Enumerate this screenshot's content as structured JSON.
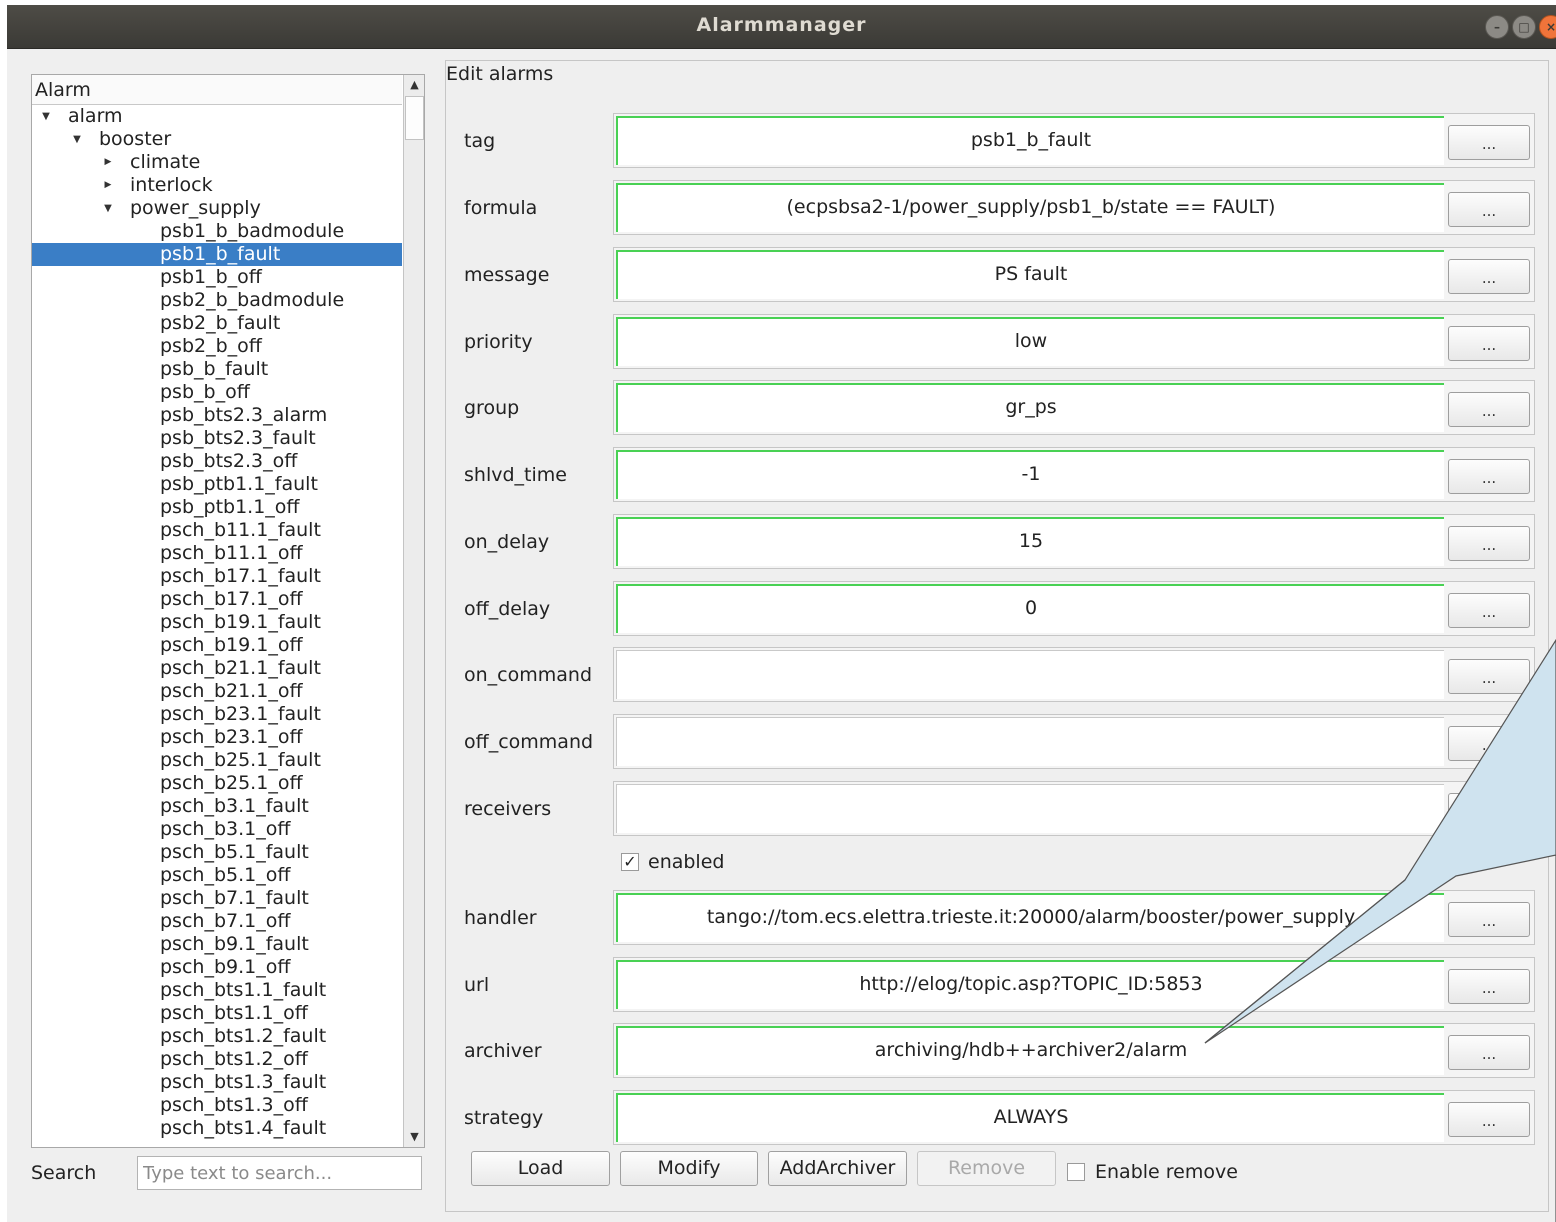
{
  "window": {
    "title": "Alarmmanager"
  },
  "tree": {
    "header": "Alarm",
    "rows": [
      {
        "label": "alarm",
        "depth": 0,
        "arrow": "down"
      },
      {
        "label": "booster",
        "depth": 1,
        "arrow": "down"
      },
      {
        "label": "climate",
        "depth": 2,
        "arrow": "right"
      },
      {
        "label": "interlock",
        "depth": 2,
        "arrow": "right"
      },
      {
        "label": "power_supply",
        "depth": 2,
        "arrow": "down"
      },
      {
        "label": "psb1_b_badmodule",
        "depth": 3
      },
      {
        "label": "psb1_b_fault",
        "depth": 3,
        "selected": true
      },
      {
        "label": "psb1_b_off",
        "depth": 3
      },
      {
        "label": "psb2_b_badmodule",
        "depth": 3
      },
      {
        "label": "psb2_b_fault",
        "depth": 3
      },
      {
        "label": "psb2_b_off",
        "depth": 3
      },
      {
        "label": "psb_b_fault",
        "depth": 3
      },
      {
        "label": "psb_b_off",
        "depth": 3
      },
      {
        "label": "psb_bts2.3_alarm",
        "depth": 3
      },
      {
        "label": "psb_bts2.3_fault",
        "depth": 3
      },
      {
        "label": "psb_bts2.3_off",
        "depth": 3
      },
      {
        "label": "psb_ptb1.1_fault",
        "depth": 3
      },
      {
        "label": "psb_ptb1.1_off",
        "depth": 3
      },
      {
        "label": "psch_b11.1_fault",
        "depth": 3
      },
      {
        "label": "psch_b11.1_off",
        "depth": 3
      },
      {
        "label": "psch_b17.1_fault",
        "depth": 3
      },
      {
        "label": "psch_b17.1_off",
        "depth": 3
      },
      {
        "label": "psch_b19.1_fault",
        "depth": 3
      },
      {
        "label": "psch_b19.1_off",
        "depth": 3
      },
      {
        "label": "psch_b21.1_fault",
        "depth": 3
      },
      {
        "label": "psch_b21.1_off",
        "depth": 3
      },
      {
        "label": "psch_b23.1_fault",
        "depth": 3
      },
      {
        "label": "psch_b23.1_off",
        "depth": 3
      },
      {
        "label": "psch_b25.1_fault",
        "depth": 3
      },
      {
        "label": "psch_b25.1_off",
        "depth": 3
      },
      {
        "label": "psch_b3.1_fault",
        "depth": 3
      },
      {
        "label": "psch_b3.1_off",
        "depth": 3
      },
      {
        "label": "psch_b5.1_fault",
        "depth": 3
      },
      {
        "label": "psch_b5.1_off",
        "depth": 3
      },
      {
        "label": "psch_b7.1_fault",
        "depth": 3
      },
      {
        "label": "psch_b7.1_off",
        "depth": 3
      },
      {
        "label": "psch_b9.1_fault",
        "depth": 3
      },
      {
        "label": "psch_b9.1_off",
        "depth": 3
      },
      {
        "label": "psch_bts1.1_fault",
        "depth": 3
      },
      {
        "label": "psch_bts1.1_off",
        "depth": 3
      },
      {
        "label": "psch_bts1.2_fault",
        "depth": 3
      },
      {
        "label": "psch_bts1.2_off",
        "depth": 3
      },
      {
        "label": "psch_bts1.3_fault",
        "depth": 3
      },
      {
        "label": "psch_bts1.3_off",
        "depth": 3
      },
      {
        "label": "psch_bts1.4_fault",
        "depth": 3
      }
    ]
  },
  "search": {
    "label": "Search",
    "placeholder": "Type text to search..."
  },
  "editor": {
    "title": "Edit alarms",
    "dots_label": "...",
    "fields": [
      {
        "key": "tag",
        "label": "tag",
        "value": "psb1_b_fault"
      },
      {
        "key": "formula",
        "label": "formula",
        "value": "(ecpsbsa2-1/power_supply/psb1_b/state == FAULT)"
      },
      {
        "key": "message",
        "label": "message",
        "value": "PS fault"
      },
      {
        "key": "priority",
        "label": "priority",
        "value": "low"
      },
      {
        "key": "group",
        "label": "group",
        "value": "gr_ps"
      },
      {
        "key": "shlvd_time",
        "label": "shlvd_time",
        "value": "-1"
      },
      {
        "key": "on_delay",
        "label": "on_delay",
        "value": "15"
      },
      {
        "key": "off_delay",
        "label": "off_delay",
        "value": "0"
      },
      {
        "key": "on_command",
        "label": "on_command",
        "value": ""
      },
      {
        "key": "off_command",
        "label": "off_command",
        "value": ""
      },
      {
        "key": "receivers",
        "label": "receivers",
        "value": ""
      },
      {
        "key": "handler",
        "label": "handler",
        "value": "tango://tom.ecs.elettra.trieste.it:20000/alarm/booster/power_supply"
      },
      {
        "key": "url",
        "label": "url",
        "value": "http://elog/topic.asp?TOPIC_ID:5853"
      },
      {
        "key": "archiver",
        "label": "archiver",
        "value": "archiving/hdb++archiver2/alarm"
      },
      {
        "key": "strategy",
        "label": "strategy",
        "value": "ALWAYS"
      }
    ],
    "enabled": {
      "label": "enabled",
      "checked": true
    },
    "buttons": {
      "load": "Load",
      "modify": "Modify",
      "add_archiver": "AddArchiver",
      "remove": "Remove"
    },
    "enable_remove": {
      "label": "Enable remove",
      "checked": false
    }
  },
  "colors": {
    "selection": "#3a7ec6",
    "valid_border": "#49d154",
    "tooltip_fill": "#cfe3ef",
    "close_button": "#f0743a"
  }
}
